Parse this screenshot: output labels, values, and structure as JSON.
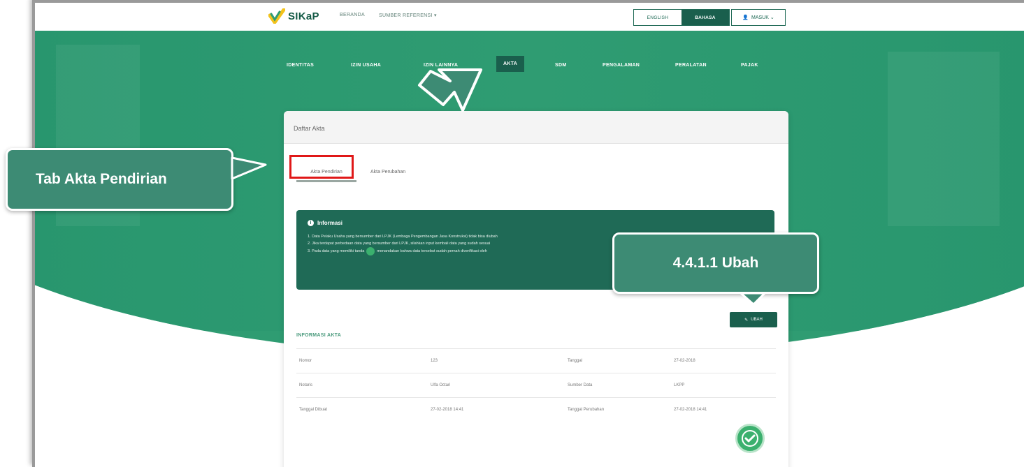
{
  "topbar": {
    "logo_text": "SIKaP",
    "nav_links": [
      "BERANDA",
      "SUMBER REFERENSI ▾"
    ],
    "lang_english": "ENGLISH",
    "lang_bahasa": "BAHASA",
    "user_label": "MASUK ⌄"
  },
  "main_tabs": [
    "IDENTITAS",
    "IZIN USAHA",
    "IZIN LAINNYA",
    "AKTA",
    "SDM",
    "PENGALAMAN",
    "PERALATAN",
    "PAJAK"
  ],
  "card": {
    "title": "Daftar Akta",
    "sub_tabs": [
      "Akta Pendirian",
      "Akta Perubahan"
    ]
  },
  "info": {
    "title": "Informasi",
    "lines": [
      "1. Data Pelaku Usaha yang bersumber dari LPJK (Lembaga Pengembangan Jasa Konstruksi) tidak bisa diubah",
      "2. Jika terdapat perbedaan data yang bersumber dari LPJK, silahkan input kembali data yang sudah sesuai",
      "3. Pada data yang memiliki tanda",
      "menandakan bahwa data tersebut sudah pernah diverifikasi oleh"
    ]
  },
  "ubah_button": "UBAH",
  "section_title": "INFORMASI AKTA",
  "table_rows": [
    [
      "Nomor",
      "123",
      "Tanggal",
      "27-02-2018"
    ],
    [
      "Notaris",
      "Ulfa Octari",
      "Sumber Data",
      "LKPP"
    ],
    [
      "Tanggal Dibuat",
      "27-02-2018 14:41",
      "Tanggal Perubahan",
      "27-02-2018 14:41"
    ]
  ],
  "callouts": {
    "left": "Tab Akta Pendirian",
    "right": "4.4.1.1 Ubah"
  },
  "colors": {
    "brand_green": "#1a5f4d",
    "hero_green": "#2f9c72",
    "callout_green": "#3d8b74",
    "highlight_red": "#e01818"
  }
}
